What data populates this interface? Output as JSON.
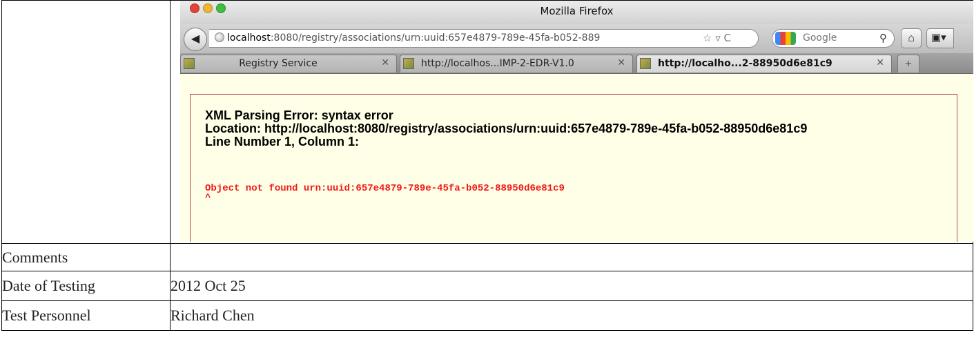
{
  "window": {
    "title": "Mozilla Firefox"
  },
  "navbar": {
    "url_host": "localhost",
    "url_path": ":8080/registry/associations/urn:uuid:657e4879-789e-45fa-b052-889",
    "url_icons": "☆ ▿ C",
    "search_placeholder": "Google"
  },
  "tabs": [
    {
      "label": "Registry Service",
      "active": false
    },
    {
      "label": "http://localhos...IMP-2-EDR-V1.0",
      "active": false
    },
    {
      "label": "http://localho...2-88950d6e81c9",
      "active": true
    }
  ],
  "error": {
    "title": "XML Parsing Error: syntax error",
    "location": "Location: http://localhost:8080/registry/associations/urn:uuid:657e4879-789e-45fa-b052-88950d6e81c9",
    "line": "Line Number 1, Column 1:",
    "source_line": "Object not found urn:uuid:657e4879-789e-45fa-b052-88950d6e81c9",
    "caret": "^"
  },
  "doc_table": {
    "rows": [
      {
        "label": "Comments",
        "value": ""
      },
      {
        "label": "Date of Testing",
        "value": "2012 Oct 25"
      },
      {
        "label": "Test Personnel",
        "value": "Richard Chen"
      }
    ]
  }
}
